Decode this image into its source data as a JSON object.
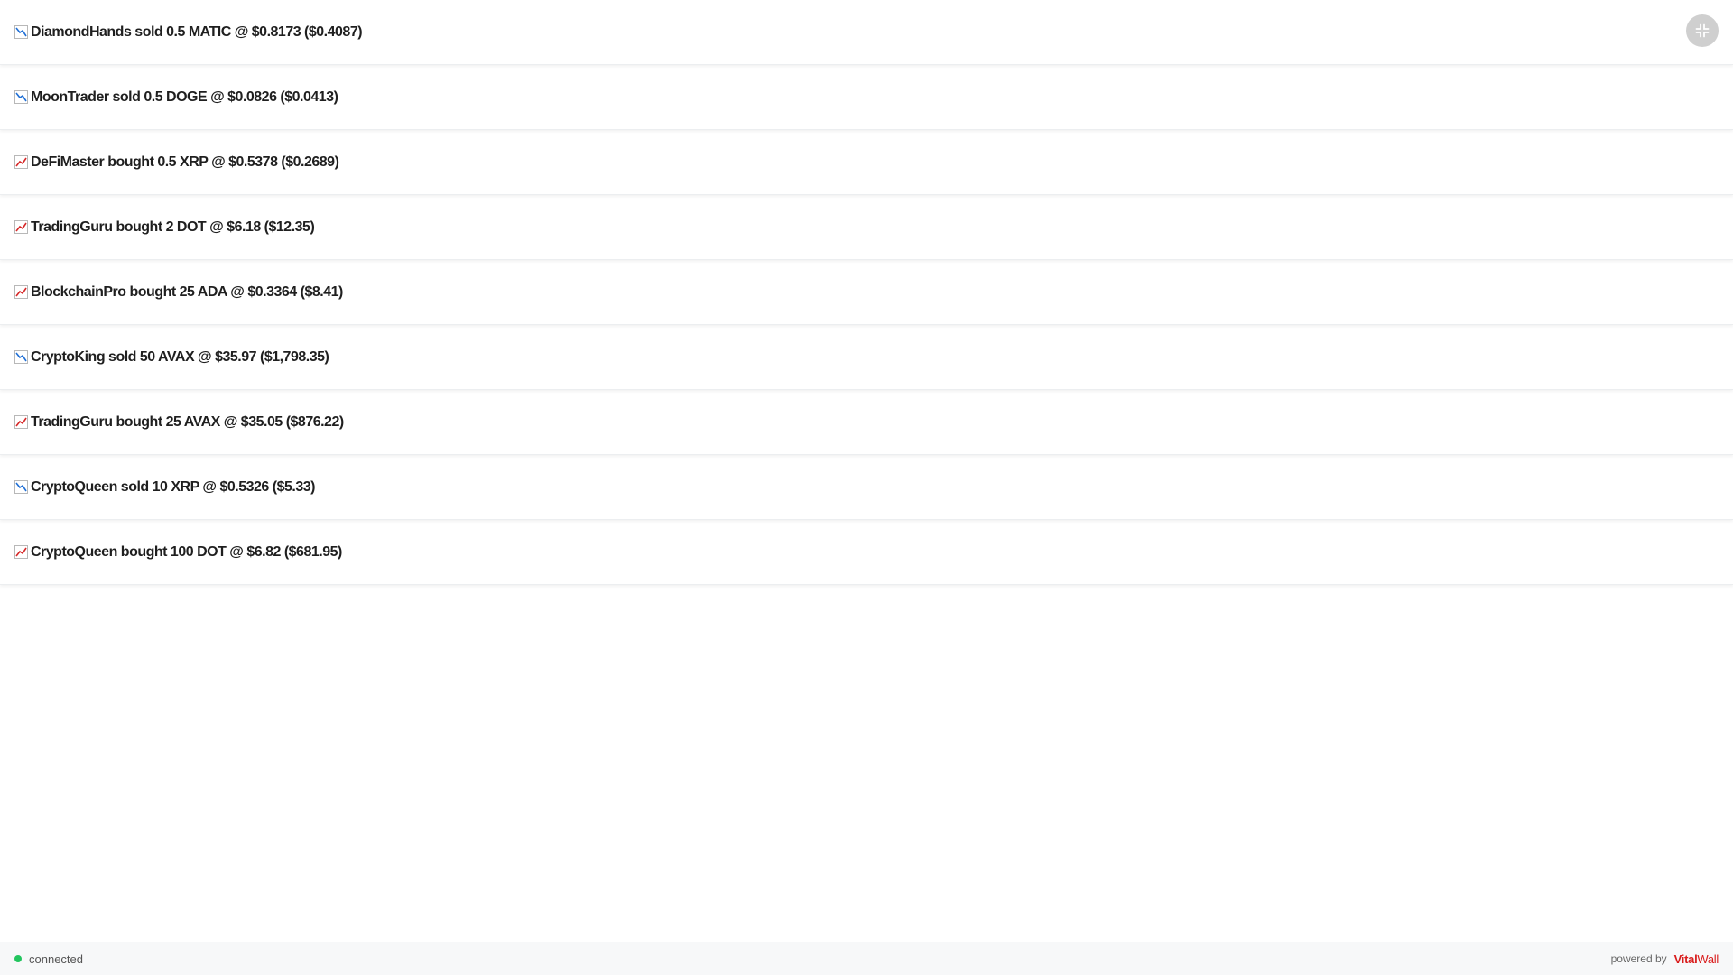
{
  "trades": [
    {
      "direction": "down",
      "text": "DiamondHands sold 0.5 MATIC @ $0.8173 ($0.4087)"
    },
    {
      "direction": "down",
      "text": "MoonTrader sold 0.5 DOGE @ $0.0826 ($0.0413)"
    },
    {
      "direction": "up",
      "text": "DeFiMaster bought 0.5 XRP @ $0.5378 ($0.2689)"
    },
    {
      "direction": "up",
      "text": "TradingGuru bought 2 DOT @ $6.18 ($12.35)"
    },
    {
      "direction": "up",
      "text": "BlockchainPro bought 25 ADA @ $0.3364 ($8.41)"
    },
    {
      "direction": "down",
      "text": "CryptoKing sold 50 AVAX @ $35.97 ($1,798.35)"
    },
    {
      "direction": "up",
      "text": "TradingGuru bought 25 AVAX @ $35.05 ($876.22)"
    },
    {
      "direction": "down",
      "text": "CryptoQueen sold 10 XRP @ $0.5326 ($5.33)"
    },
    {
      "direction": "up",
      "text": "CryptoQueen bought 100 DOT @ $6.82 ($681.95)"
    }
  ],
  "icons": {
    "up": "chart-increasing-icon",
    "down": "chart-decreasing-icon",
    "fullscreen": "exit-fullscreen-icon"
  },
  "footer": {
    "status_text": "connected",
    "powered_by": "powered by",
    "brand_part1": "Vital",
    "brand_part2": "Wall"
  },
  "colors": {
    "status_dot": "#22c55e",
    "brand_part1": "#d91c1c",
    "brand_part2": "#d91c1c",
    "trend_up": "#d62828",
    "trend_down": "#1f6fd6"
  }
}
